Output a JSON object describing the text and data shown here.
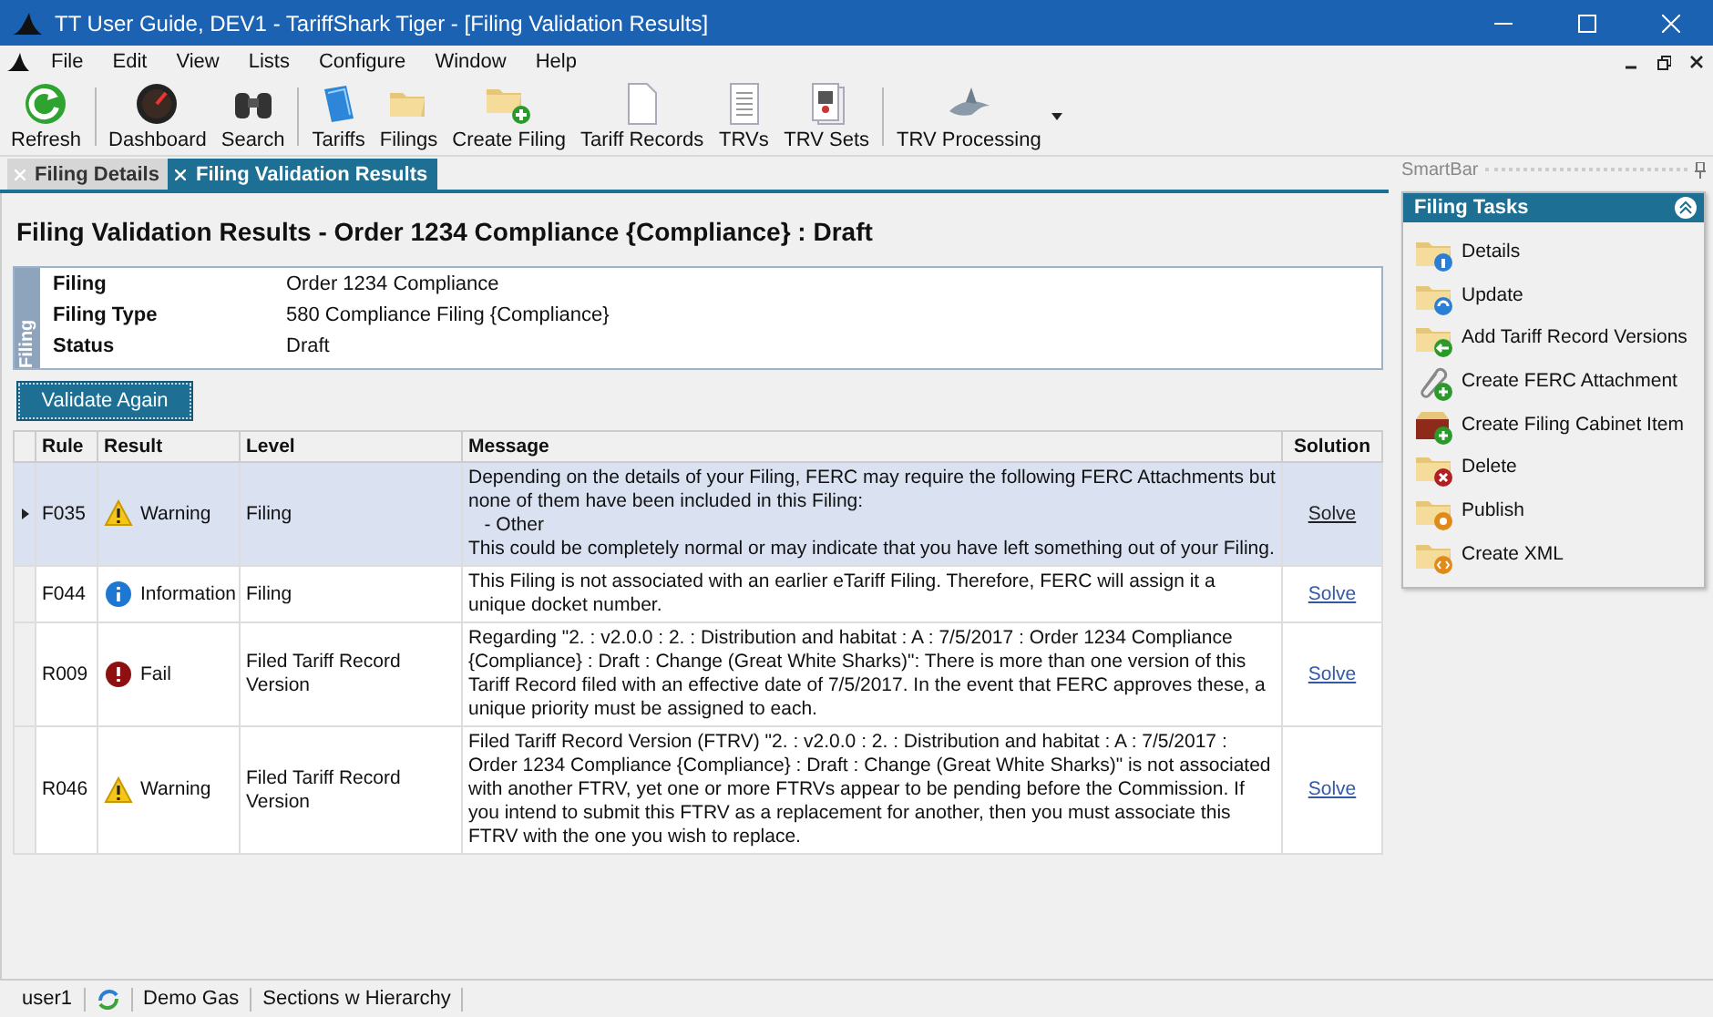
{
  "window": {
    "title": "TT User Guide, DEV1 - TariffShark Tiger - [Filing Validation Results]"
  },
  "menu": [
    "File",
    "Edit",
    "View",
    "Lists",
    "Configure",
    "Window",
    "Help"
  ],
  "toolbar": [
    "Refresh",
    "Dashboard",
    "Search",
    "Tariffs",
    "Filings",
    "Create Filing",
    "Tariff Records",
    "TRVs",
    "TRV Sets",
    "TRV Processing"
  ],
  "tabs": [
    {
      "label": "Filing Details",
      "selected": false
    },
    {
      "label": "Filing Validation Results",
      "selected": true
    }
  ],
  "heading": "Filing Validation Results - Order 1234 Compliance {Compliance} : Draft",
  "filing_panel": {
    "tab": "Filing",
    "fields": [
      {
        "label": "Filing",
        "value": "Order 1234 Compliance"
      },
      {
        "label": "Filing Type",
        "value": "580 Compliance Filing {Compliance}"
      },
      {
        "label": "Status",
        "value": "Draft"
      }
    ]
  },
  "validate_button": "Validate Again",
  "table": {
    "columns": [
      "Rule",
      "Result",
      "Level",
      "Message",
      "Solution"
    ],
    "rows": [
      {
        "selected": true,
        "rule": "F035",
        "result": "Warning",
        "kind": "warning",
        "level": "Filing",
        "message": "Depending on the details of your Filing, FERC may require the following FERC Attachments but none of them have been included in this Filing:\n   - Other\nThis could be completely normal or may indicate that you have left something out of your Filing.",
        "solution": "Solve"
      },
      {
        "selected": false,
        "rule": "F044",
        "result": "Information",
        "kind": "information",
        "level": "Filing",
        "message": "This Filing is not associated with an earlier eTariff Filing. Therefore, FERC will assign it a unique docket number.",
        "solution": "Solve"
      },
      {
        "selected": false,
        "rule": "R009",
        "result": "Fail",
        "kind": "fail",
        "level": "Filed Tariff Record Version",
        "message": "Regarding \"2. : v2.0.0 : 2. : Distribution and habitat : A : 7/5/2017 : Order 1234 Compliance {Compliance} : Draft : Change (Great White Sharks)\": There is more than one version of this Tariff Record filed with an effective date of 7/5/2017. In the event that FERC approves these, a unique priority must be assigned to each.",
        "solution": "Solve"
      },
      {
        "selected": false,
        "rule": "R046",
        "result": "Warning",
        "kind": "warning",
        "level": "Filed Tariff Record Version",
        "message": "Filed Tariff Record Version (FTRV) \"2. : v2.0.0 : 2. : Distribution and habitat : A : 7/5/2017 : Order 1234 Compliance {Compliance} : Draft : Change (Great White Sharks)\" is not associated with another FTRV, yet one or more FTRVs appear to be pending before the Commission. If you intend to submit this FTRV as a replacement for another, then you must associate this FTRV with the one you wish to replace.",
        "solution": "Solve"
      }
    ]
  },
  "smartbar": {
    "title": "SmartBar",
    "panel_title": "Filing Tasks",
    "expanded": true,
    "items": [
      "Details",
      "Update",
      "Add Tariff Record Versions",
      "Create FERC Attachment",
      "Create Filing Cabinet Item",
      "Delete",
      "Publish",
      "Create XML"
    ]
  },
  "status_bar": {
    "user": "user1",
    "database": "Demo Gas",
    "layout": "Sections w Hierarchy"
  }
}
